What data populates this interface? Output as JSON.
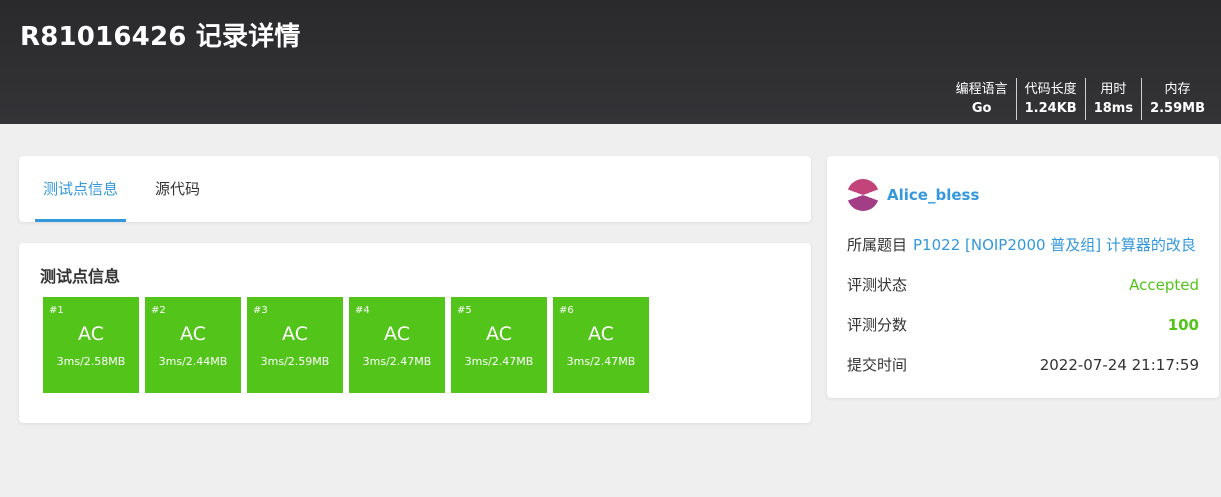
{
  "header": {
    "title": "R81016426 记录详情",
    "stats": [
      {
        "label": "编程语言",
        "value": "Go"
      },
      {
        "label": "代码长度",
        "value": "1.24KB"
      },
      {
        "label": "用时",
        "value": "18ms"
      },
      {
        "label": "内存",
        "value": "2.59MB"
      }
    ]
  },
  "tabs": [
    {
      "label": "测试点信息",
      "active": true
    },
    {
      "label": "源代码",
      "active": false
    }
  ],
  "cases_section": {
    "title": "测试点信息",
    "cases": [
      {
        "id": "#1",
        "status": "AC",
        "detail": "3ms/2.58MB"
      },
      {
        "id": "#2",
        "status": "AC",
        "detail": "3ms/2.44MB"
      },
      {
        "id": "#3",
        "status": "AC",
        "detail": "3ms/2.59MB"
      },
      {
        "id": "#4",
        "status": "AC",
        "detail": "3ms/2.47MB"
      },
      {
        "id": "#5",
        "status": "AC",
        "detail": "3ms/2.47MB"
      },
      {
        "id": "#6",
        "status": "AC",
        "detail": "3ms/2.47MB"
      }
    ]
  },
  "info": {
    "username": "Alice_bless",
    "problem_label": "所属题目",
    "problem_value": "P1022 [NOIP2000 普及组] 计算器的改良",
    "status_label": "评测状态",
    "status_value": "Accepted",
    "score_label": "评测分数",
    "score_value": "100",
    "time_label": "提交时间",
    "time_value": "2022-07-24 21:17:59"
  },
  "colors": {
    "accent": "#3498db",
    "ac_green": "#52c41a",
    "header_bg": "#2a2a2c"
  }
}
